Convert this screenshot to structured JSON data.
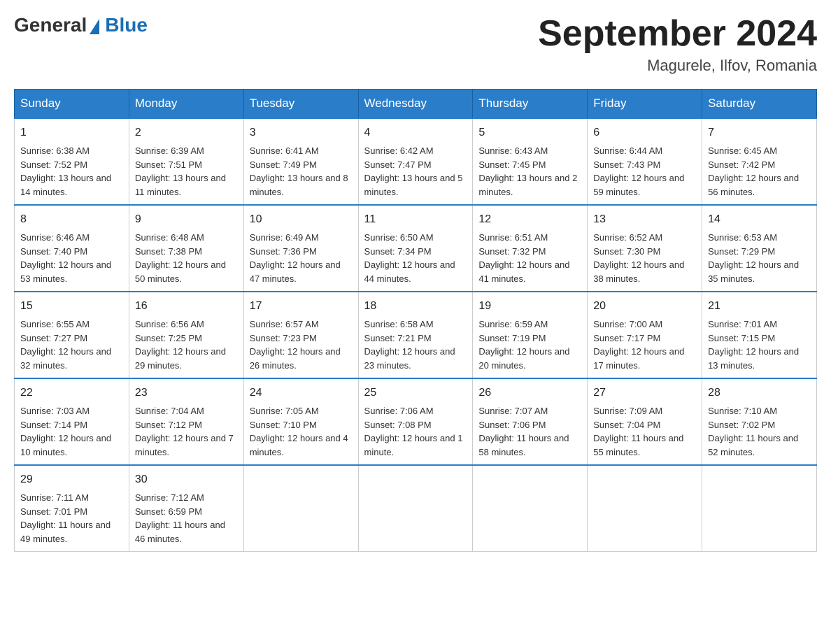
{
  "header": {
    "logo_general": "General",
    "logo_blue": "Blue",
    "title": "September 2024",
    "location": "Magurele, Ilfov, Romania"
  },
  "days_of_week": [
    "Sunday",
    "Monday",
    "Tuesday",
    "Wednesday",
    "Thursday",
    "Friday",
    "Saturday"
  ],
  "weeks": [
    [
      {
        "day": "1",
        "sunrise": "Sunrise: 6:38 AM",
        "sunset": "Sunset: 7:52 PM",
        "daylight": "Daylight: 13 hours and 14 minutes."
      },
      {
        "day": "2",
        "sunrise": "Sunrise: 6:39 AM",
        "sunset": "Sunset: 7:51 PM",
        "daylight": "Daylight: 13 hours and 11 minutes."
      },
      {
        "day": "3",
        "sunrise": "Sunrise: 6:41 AM",
        "sunset": "Sunset: 7:49 PM",
        "daylight": "Daylight: 13 hours and 8 minutes."
      },
      {
        "day": "4",
        "sunrise": "Sunrise: 6:42 AM",
        "sunset": "Sunset: 7:47 PM",
        "daylight": "Daylight: 13 hours and 5 minutes."
      },
      {
        "day": "5",
        "sunrise": "Sunrise: 6:43 AM",
        "sunset": "Sunset: 7:45 PM",
        "daylight": "Daylight: 13 hours and 2 minutes."
      },
      {
        "day": "6",
        "sunrise": "Sunrise: 6:44 AM",
        "sunset": "Sunset: 7:43 PM",
        "daylight": "Daylight: 12 hours and 59 minutes."
      },
      {
        "day": "7",
        "sunrise": "Sunrise: 6:45 AM",
        "sunset": "Sunset: 7:42 PM",
        "daylight": "Daylight: 12 hours and 56 minutes."
      }
    ],
    [
      {
        "day": "8",
        "sunrise": "Sunrise: 6:46 AM",
        "sunset": "Sunset: 7:40 PM",
        "daylight": "Daylight: 12 hours and 53 minutes."
      },
      {
        "day": "9",
        "sunrise": "Sunrise: 6:48 AM",
        "sunset": "Sunset: 7:38 PM",
        "daylight": "Daylight: 12 hours and 50 minutes."
      },
      {
        "day": "10",
        "sunrise": "Sunrise: 6:49 AM",
        "sunset": "Sunset: 7:36 PM",
        "daylight": "Daylight: 12 hours and 47 minutes."
      },
      {
        "day": "11",
        "sunrise": "Sunrise: 6:50 AM",
        "sunset": "Sunset: 7:34 PM",
        "daylight": "Daylight: 12 hours and 44 minutes."
      },
      {
        "day": "12",
        "sunrise": "Sunrise: 6:51 AM",
        "sunset": "Sunset: 7:32 PM",
        "daylight": "Daylight: 12 hours and 41 minutes."
      },
      {
        "day": "13",
        "sunrise": "Sunrise: 6:52 AM",
        "sunset": "Sunset: 7:30 PM",
        "daylight": "Daylight: 12 hours and 38 minutes."
      },
      {
        "day": "14",
        "sunrise": "Sunrise: 6:53 AM",
        "sunset": "Sunset: 7:29 PM",
        "daylight": "Daylight: 12 hours and 35 minutes."
      }
    ],
    [
      {
        "day": "15",
        "sunrise": "Sunrise: 6:55 AM",
        "sunset": "Sunset: 7:27 PM",
        "daylight": "Daylight: 12 hours and 32 minutes."
      },
      {
        "day": "16",
        "sunrise": "Sunrise: 6:56 AM",
        "sunset": "Sunset: 7:25 PM",
        "daylight": "Daylight: 12 hours and 29 minutes."
      },
      {
        "day": "17",
        "sunrise": "Sunrise: 6:57 AM",
        "sunset": "Sunset: 7:23 PM",
        "daylight": "Daylight: 12 hours and 26 minutes."
      },
      {
        "day": "18",
        "sunrise": "Sunrise: 6:58 AM",
        "sunset": "Sunset: 7:21 PM",
        "daylight": "Daylight: 12 hours and 23 minutes."
      },
      {
        "day": "19",
        "sunrise": "Sunrise: 6:59 AM",
        "sunset": "Sunset: 7:19 PM",
        "daylight": "Daylight: 12 hours and 20 minutes."
      },
      {
        "day": "20",
        "sunrise": "Sunrise: 7:00 AM",
        "sunset": "Sunset: 7:17 PM",
        "daylight": "Daylight: 12 hours and 17 minutes."
      },
      {
        "day": "21",
        "sunrise": "Sunrise: 7:01 AM",
        "sunset": "Sunset: 7:15 PM",
        "daylight": "Daylight: 12 hours and 13 minutes."
      }
    ],
    [
      {
        "day": "22",
        "sunrise": "Sunrise: 7:03 AM",
        "sunset": "Sunset: 7:14 PM",
        "daylight": "Daylight: 12 hours and 10 minutes."
      },
      {
        "day": "23",
        "sunrise": "Sunrise: 7:04 AM",
        "sunset": "Sunset: 7:12 PM",
        "daylight": "Daylight: 12 hours and 7 minutes."
      },
      {
        "day": "24",
        "sunrise": "Sunrise: 7:05 AM",
        "sunset": "Sunset: 7:10 PM",
        "daylight": "Daylight: 12 hours and 4 minutes."
      },
      {
        "day": "25",
        "sunrise": "Sunrise: 7:06 AM",
        "sunset": "Sunset: 7:08 PM",
        "daylight": "Daylight: 12 hours and 1 minute."
      },
      {
        "day": "26",
        "sunrise": "Sunrise: 7:07 AM",
        "sunset": "Sunset: 7:06 PM",
        "daylight": "Daylight: 11 hours and 58 minutes."
      },
      {
        "day": "27",
        "sunrise": "Sunrise: 7:09 AM",
        "sunset": "Sunset: 7:04 PM",
        "daylight": "Daylight: 11 hours and 55 minutes."
      },
      {
        "day": "28",
        "sunrise": "Sunrise: 7:10 AM",
        "sunset": "Sunset: 7:02 PM",
        "daylight": "Daylight: 11 hours and 52 minutes."
      }
    ],
    [
      {
        "day": "29",
        "sunrise": "Sunrise: 7:11 AM",
        "sunset": "Sunset: 7:01 PM",
        "daylight": "Daylight: 11 hours and 49 minutes."
      },
      {
        "day": "30",
        "sunrise": "Sunrise: 7:12 AM",
        "sunset": "Sunset: 6:59 PM",
        "daylight": "Daylight: 11 hours and 46 minutes."
      },
      null,
      null,
      null,
      null,
      null
    ]
  ]
}
